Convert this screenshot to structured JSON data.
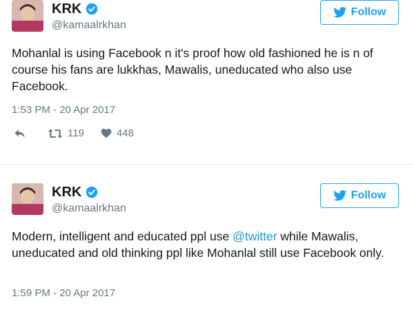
{
  "tweets": [
    {
      "display_name": "KRK",
      "handle": "@kamaalrkhan",
      "follow_label": "Follow",
      "text": "Mohanlal is using Facebook n it's proof how old fashioned he is n of course his fans are lukkhas, Mawalis, uneducated who also use Facebook.",
      "timestamp": "1:53 PM - 20 Apr 2017",
      "retweets": "119",
      "likes": "448"
    },
    {
      "display_name": "KRK",
      "handle": "@kamaalrkhan",
      "follow_label": "Follow",
      "text_before": "Modern, intelligent and educated ppl use ",
      "mention": "@twitter",
      "text_after": " while Mawalis, uneducated and old thinking ppl like Mohanlal still use Facebook only.",
      "timestamp": "1:59 PM - 20 Apr 2017"
    }
  ],
  "icons": {
    "verified": "verified-badge-icon",
    "bird": "twitter-bird-icon",
    "reply": "reply-icon",
    "retweet": "retweet-icon",
    "like": "heart-icon"
  },
  "colors": {
    "accent": "#1da1f2",
    "mention": "#1b95e0",
    "secondary_text": "#657786",
    "divider": "#e1e8ed"
  }
}
